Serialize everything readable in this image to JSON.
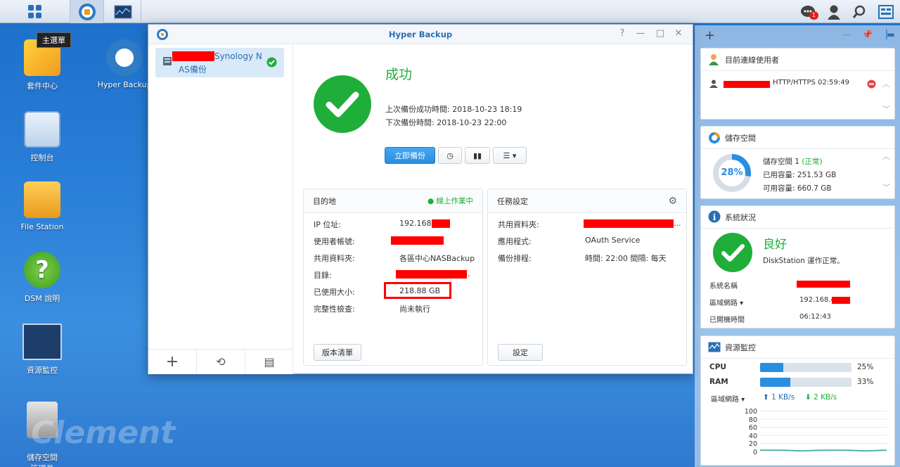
{
  "taskbar": {
    "notif_count": "1"
  },
  "desktop": {
    "icons": [
      "套件中心",
      "Hyper Backup",
      "控制台",
      "File Station",
      "DSM 說明",
      "資源監控",
      "儲存空間\n管理員"
    ],
    "tooltip": "主選單",
    "watermark": "Clement"
  },
  "window": {
    "title": "Hyper Backup",
    "controls": [
      "?",
      "—",
      "□",
      "✕"
    ],
    "task": {
      "line1_suffix": "Synology N",
      "line2": "AS備份"
    },
    "status": {
      "title": "成功",
      "last_backup": "上次備份成功時間: 2018-10-23 18:19",
      "next_backup": "下次備份時間: 2018-10-23 22:00",
      "backup_now": "立即備份"
    },
    "destination": {
      "header": "目的地",
      "online": "線上作業中",
      "rows": [
        {
          "label": "IP 位址:",
          "value": "192.168."
        },
        {
          "label": "使用者帳號:",
          "value": ""
        },
        {
          "label": "共用資料夾:",
          "value": "各區中心NASBackup"
        },
        {
          "label": "目錄:",
          "value": "."
        },
        {
          "label": "已使用大小:",
          "value": "218.88 GB"
        },
        {
          "label": "完整性檢查:",
          "value": "尚未執行"
        }
      ],
      "version_btn": "版本清單"
    },
    "task_settings": {
      "header": "任務設定",
      "rows": [
        {
          "label": "共用資料夾:",
          "value": "..."
        },
        {
          "label": "應用程式:",
          "value": "OAuth Service"
        },
        {
          "label": "備份排程:",
          "value": "時間: 22:00 間隔: 每天"
        }
      ],
      "settings_btn": "設定"
    }
  },
  "right_panel": {
    "users": {
      "title": "目前連線使用者",
      "entry": "HTTP/HTTPS 02:59:49"
    },
    "storage": {
      "title": "儲存空間",
      "percent": "28",
      "percent_label": "28%",
      "vol_name": "儲存空間 1",
      "vol_status": "(正常)",
      "used": "已用容量: 251.53 GB",
      "free": "可用容量: 660.7 GB"
    },
    "health": {
      "title": "系統狀況",
      "status": "良好",
      "desc": "DiskStation 運作正常。",
      "rows": [
        {
          "label": "系統名稱",
          "value": ""
        },
        {
          "label": "區域網路 ▾",
          "value": "192.168.4"
        },
        {
          "label": "已開機時間",
          "value": "06:12:43"
        }
      ]
    },
    "resource": {
      "title": "資源監控",
      "cpu_label": "CPU",
      "cpu": "25%",
      "cpu_frac": 0.25,
      "ram_label": "RAM",
      "ram": "33%",
      "ram_frac": 0.33,
      "lan_label": "區域網路 ▾",
      "up": "1 KB/s",
      "down": "2 KB/s",
      "yticks": [
        "100",
        "80",
        "60",
        "40",
        "20",
        "0"
      ]
    }
  },
  "colors": {
    "accent": "#2a8ee0",
    "success": "#1fae3a",
    "red": "#ff0000"
  }
}
